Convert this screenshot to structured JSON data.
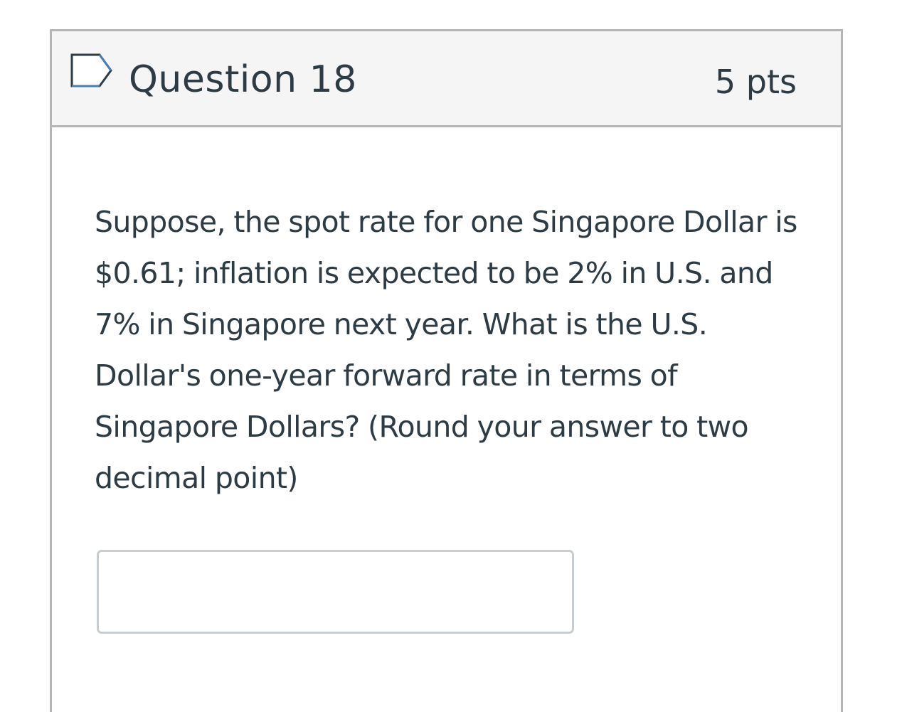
{
  "question": {
    "title": "Question 18",
    "points": "5 pts",
    "flag_icon": "flag-outline-icon",
    "text": "Suppose, the spot rate for one Singapore Dollar is $0.61; inflation is expected to be 2% in U.S. and 7% in Singapore next year.  What is the U.S. Dollar's one-year forward rate in terms of Singapore Dollars? (Round your answer to two decimal point)",
    "answer": {
      "value": "",
      "placeholder": ""
    }
  },
  "colors": {
    "header_bg": "#f5f5f5",
    "border": "#b5b5b5",
    "text": "#2d3b45",
    "flag_outline": "#2d3b45",
    "flag_accent": "#4a7fb5",
    "input_border": "#c7cdd1"
  }
}
